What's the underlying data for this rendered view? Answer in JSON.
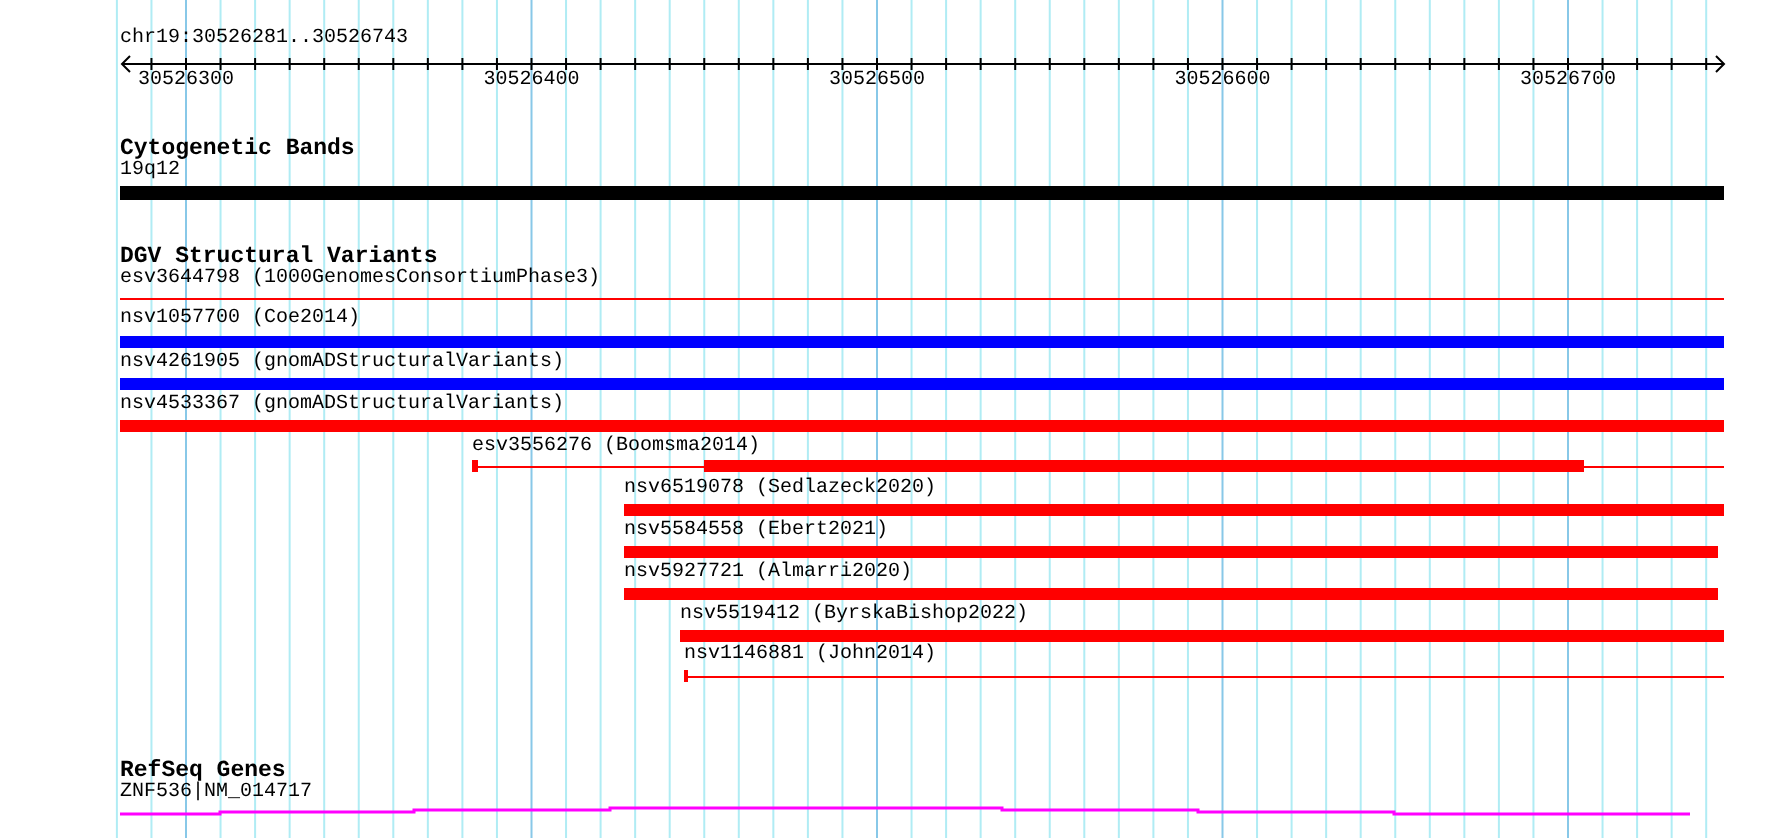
{
  "ruler": {
    "range": "chr19:30526281..30526743",
    "ticks": [
      "30526300",
      "30526400",
      "30526500",
      "30526600",
      "30526700"
    ]
  },
  "tracks": [
    {
      "title": "Cytogenetic Bands",
      "features": [
        {
          "label": "19q12",
          "kind": "band",
          "color": "#000000"
        }
      ]
    },
    {
      "title": "DGV Structural Variants",
      "features": [
        {
          "label": "esv3644798 (1000GenomesConsortiumPhase3)",
          "kind": "line",
          "color": "#ff0000"
        },
        {
          "label": "nsv1057700 (Coe2014)",
          "kind": "bar",
          "color": "#0000ff"
        },
        {
          "label": "nsv4261905 (gnomADStructuralVariants)",
          "kind": "bar",
          "color": "#0000ff"
        },
        {
          "label": "nsv4533367 (gnomADStructuralVariants)",
          "kind": "bar",
          "color": "#ff0000"
        },
        {
          "label": "esv3556276 (Boomsma2014)",
          "kind": "split",
          "color": "#ff0000"
        },
        {
          "label": "nsv6519078 (Sedlazeck2020)",
          "kind": "bar",
          "color": "#ff0000"
        },
        {
          "label": "nsv5584558 (Ebert2021)",
          "kind": "bar",
          "color": "#ff0000"
        },
        {
          "label": "nsv5927721 (Almarri2020)",
          "kind": "bar",
          "color": "#ff0000"
        },
        {
          "label": "nsv5519412 (ByrskaBishop2022)",
          "kind": "bar",
          "color": "#ff0000"
        },
        {
          "label": "nsv1146881 (John2014)",
          "kind": "line",
          "color": "#ff0000"
        }
      ]
    },
    {
      "title": "RefSeq Genes",
      "features": [
        {
          "label": "ZNF536|NM_014717",
          "kind": "gene",
          "color": "#ff00ff"
        }
      ]
    }
  ]
}
